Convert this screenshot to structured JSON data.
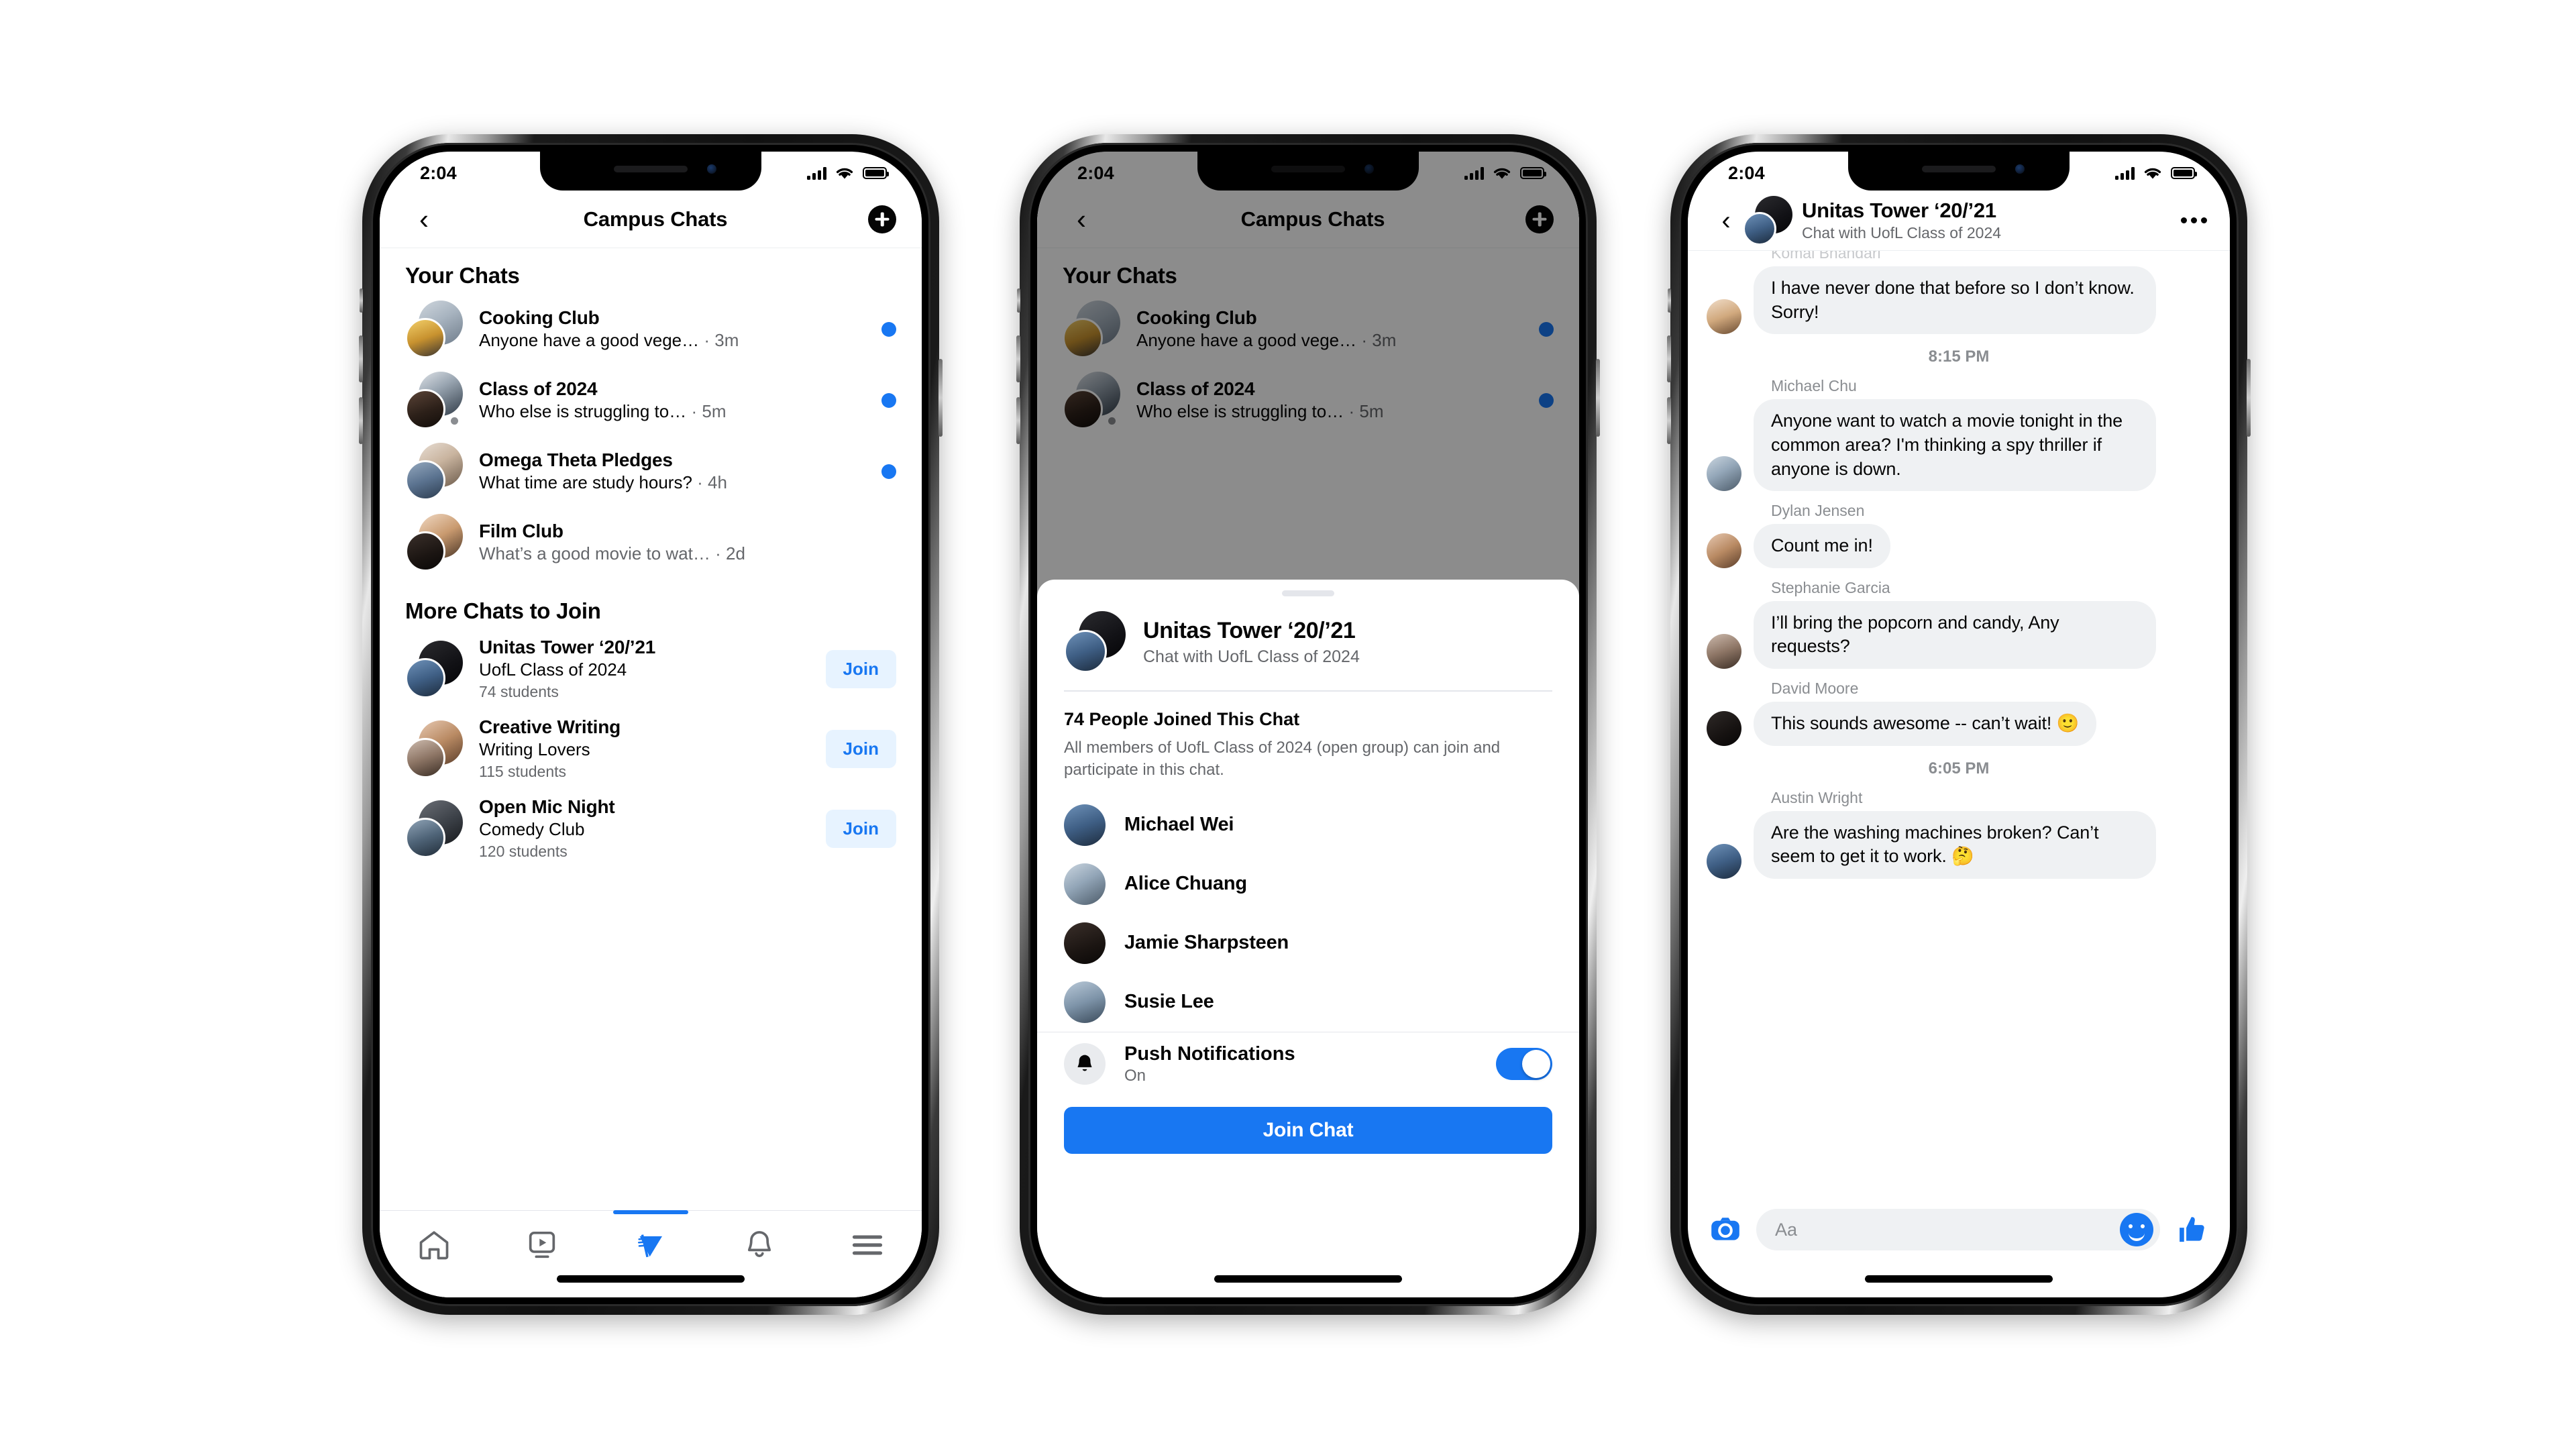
{
  "statusbar": {
    "time": "2:04"
  },
  "phone1": {
    "nav": {
      "back": "‹",
      "title": "Campus Chats",
      "add": "add-chat"
    },
    "sections": [
      {
        "title": "Your Chats"
      },
      {
        "title": "More Chats to Join"
      }
    ],
    "your_chats": [
      {
        "name": "Cooking Club",
        "preview": "Anyone have a good vege…",
        "time": "· 3m",
        "unread": true,
        "dot": false
      },
      {
        "name": "Class of 2024",
        "preview": "Who else is struggling to…",
        "time": "· 5m",
        "unread": true,
        "dot": true
      },
      {
        "name": "Omega Theta Pledges",
        "preview": "What time are study hours?",
        "time": "· 4h",
        "unread": true,
        "dot": false
      },
      {
        "name": "Film Club",
        "preview": "What’s a good movie to wat…",
        "time": "· 2d",
        "unread": false,
        "dot": false
      }
    ],
    "more_chats": [
      {
        "name": "Unitas Tower ‘20/’21",
        "group": "UofL Class of 2024",
        "members": "74 students",
        "action": "Join"
      },
      {
        "name": "Creative Writing",
        "group": "Writing Lovers",
        "members": "115 students",
        "action": "Join"
      },
      {
        "name": "Open Mic Night",
        "group": "Comedy Club",
        "members": "120 students",
        "action": "Join"
      }
    ],
    "tabs": [
      {
        "icon": "home-icon",
        "active": false
      },
      {
        "icon": "watch-video-icon",
        "active": false
      },
      {
        "icon": "campus-icon",
        "active": true
      },
      {
        "icon": "notifications-bell-icon",
        "active": false
      },
      {
        "icon": "menu-hamburger-icon",
        "active": false
      }
    ]
  },
  "phone2": {
    "nav": {
      "back": "‹",
      "title": "Campus Chats"
    },
    "background_rows": [
      {
        "name": "Cooking Club",
        "preview": "Anyone have a good vege…",
        "time": "· 3m"
      },
      {
        "name": "Class of 2024",
        "preview": "Who else is struggling to…",
        "time": "· 5m"
      }
    ],
    "section_title": "Your Chats",
    "sheet": {
      "title": "Unitas Tower ‘20/’21",
      "subtitle": "Chat with UofL Class of 2024",
      "joined_title": "74 People Joined This Chat",
      "joined_desc": "All members of UofL Class of 2024 (open group) can join and participate in this chat.",
      "members": [
        {
          "name": "Michael Wei"
        },
        {
          "name": "Alice Chuang"
        },
        {
          "name": "Jamie Sharpsteen"
        },
        {
          "name": "Susie Lee"
        }
      ],
      "push": {
        "label": "Push Notifications",
        "state": "On",
        "enabled": true
      },
      "cta": "Join Chat"
    }
  },
  "phone3": {
    "header": {
      "title": "Unitas Tower ‘20/’21",
      "subtitle": "Chat with UofL Class of 2024",
      "back": "‹"
    },
    "clipped_sender": "Komal Bhandari",
    "messages": [
      {
        "type": "message",
        "sender": "",
        "text": "I have never done that before so I don’t know. Sorry!"
      },
      {
        "type": "timestamp",
        "text": "8:15 PM"
      },
      {
        "type": "message",
        "sender": "Michael Chu",
        "text": "Anyone want to watch a movie tonight in the common area? I'm thinking a spy thriller if anyone is down."
      },
      {
        "type": "message",
        "sender": "Dylan Jensen",
        "text": "Count me in!"
      },
      {
        "type": "message",
        "sender": "Stephanie Garcia",
        "text": "I’ll bring the popcorn and candy, Any requests?"
      },
      {
        "type": "message",
        "sender": "David Moore",
        "text": "This sounds awesome -- can’t wait! 🙂"
      },
      {
        "type": "timestamp",
        "text": "6:05 PM"
      },
      {
        "type": "message",
        "sender": "Austin Wright",
        "text": "Are the washing machines broken? Can’t seem to get it to work. 🤔"
      }
    ],
    "composer": {
      "placeholder": "Aa",
      "camera": "camera-icon",
      "sticker": "smiley-icon",
      "like": "thumbs-up-icon"
    }
  },
  "colors": {
    "brand_blue": "#1877F2",
    "join_bg": "#E7F3FF",
    "bubble_gray": "#EFF1F3",
    "text_secondary": "#65676B",
    "divider": "#E4E6EB"
  }
}
